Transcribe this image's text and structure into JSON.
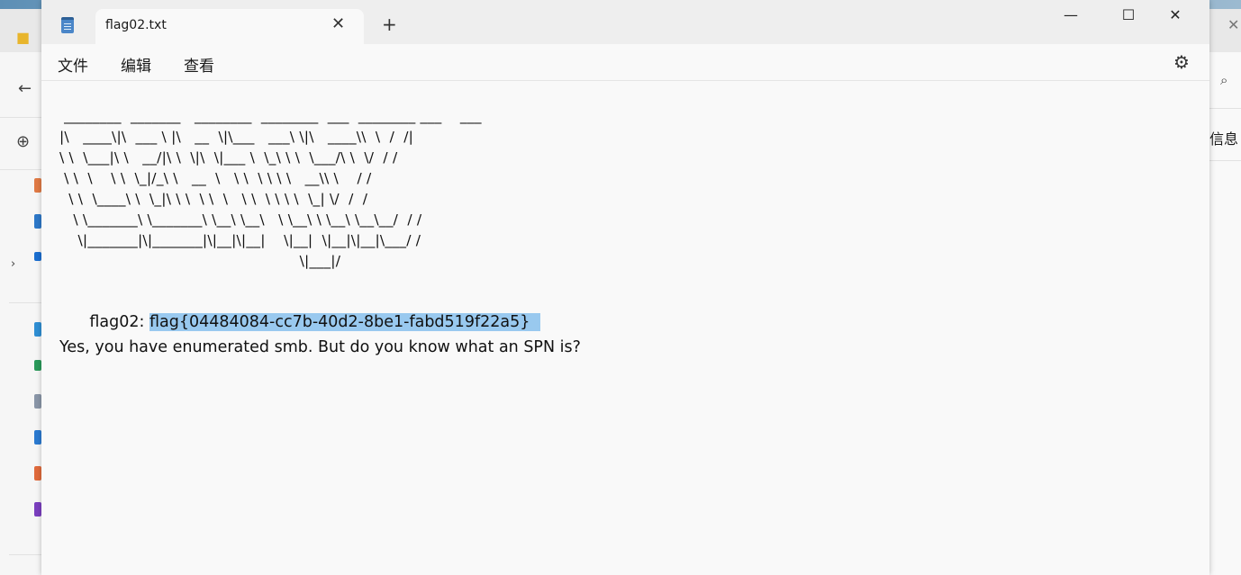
{
  "background": {
    "right_label": "信息"
  },
  "tab": {
    "title": "flag02.txt",
    "icon": "notepad-icon",
    "close_glyph": "✕",
    "new_tab_glyph": "+"
  },
  "window_controls": {
    "minimize": "—",
    "maximize": "☐",
    "close": "✕"
  },
  "menu": {
    "file": "文件",
    "edit": "编辑",
    "view": "查看",
    "settings_icon": "gear-icon"
  },
  "document": {
    "ascii_art": [
      " ________  _______   ________  ________  ___  ________ ___    ___",
      "|\\   ____\\|\\  ___ \\ |\\   __  \\|\\___   ___\\ \\|\\   ____\\\\  \\  /  /|",
      "\\ \\  \\___|\\ \\   __/|\\ \\  \\|\\  \\|___ \\  \\_\\ \\ \\  \\___/\\ \\  \\/  / /",
      " \\ \\  \\    \\ \\  \\_|/_\\ \\   __  \\   \\ \\  \\ \\ \\ \\   __\\\\ \\    / /",
      "  \\ \\  \\____\\ \\  \\_|\\ \\ \\  \\ \\  \\   \\ \\  \\ \\ \\ \\  \\_| \\/  /  /",
      "   \\ \\_______\\ \\_______\\ \\__\\ \\__\\   \\ \\__\\ \\ \\__\\ \\__\\__/  / /",
      "    \\|_______|\\|_______|\\|__|\\|__|    \\|__|  \\|__|\\|__|\\___/ /",
      "                                                    \\|___|/"
    ],
    "flag_label": "flag02: ",
    "flag_value": "flag{04484084-cc7b-40d2-8be1-fabd519f22a5}",
    "message": "Yes, you have enumerated smb. But do you know what an SPN is?"
  },
  "colors": {
    "selection": "#99c9ef",
    "window_bg": "#f9f9f9",
    "titlebar_bg": "#eeeeee"
  }
}
